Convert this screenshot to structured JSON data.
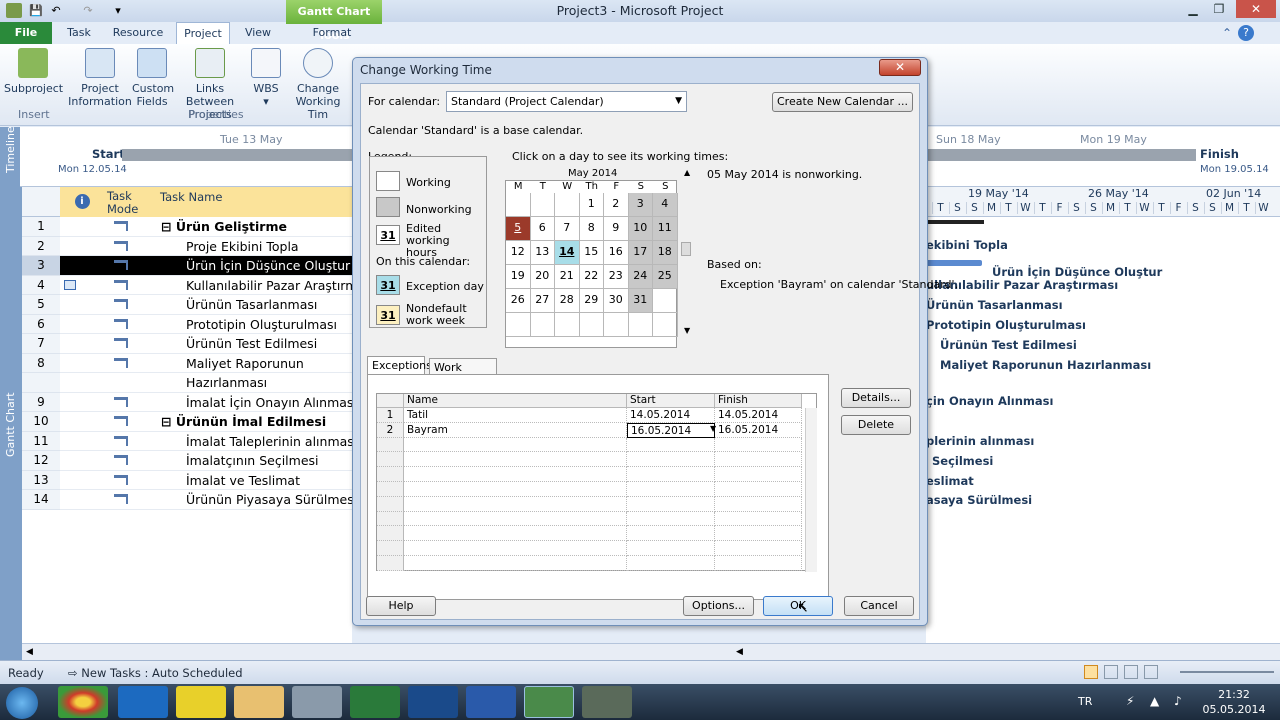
{
  "window": {
    "title": "Project3  -  Microsoft Project",
    "context_tab": "Gantt Chart Tools"
  },
  "ribbon": {
    "tabs": [
      "File",
      "Task",
      "Resource",
      "Project",
      "View",
      "Format"
    ],
    "active_tab": "Project",
    "buttons": [
      {
        "label": "Subproject",
        "label2": ""
      },
      {
        "label": "Project",
        "label2": "Information"
      },
      {
        "label": "Custom",
        "label2": "Fields"
      },
      {
        "label": "Links Between",
        "label2": "Projects"
      },
      {
        "label": "WBS",
        "label2": "▾"
      },
      {
        "label": "Change",
        "label2": "Working Tim"
      }
    ],
    "groups": [
      "Insert",
      "Properties"
    ]
  },
  "timeline": {
    "side_label": "Timeline",
    "start_label": "Start",
    "start_date": "Mon 12.05.14",
    "tue_label": "Tue 13 May",
    "sun_label": "Sun 18 May",
    "mon_label": "Mon 19 May",
    "finish_label": "Finish",
    "finish_date": "Mon 19.05.14"
  },
  "gantt": {
    "side_label": "Gantt Chart",
    "headers": {
      "info": "i",
      "mode": "Task Mode",
      "name": "Task Name"
    },
    "rows": [
      {
        "id": "1",
        "name": "⊟ Ürün Geliştirme"
      },
      {
        "id": "2",
        "name": "Proje Ekibini Topla"
      },
      {
        "id": "3",
        "name": "Ürün İçin Düşünce Oluştur"
      },
      {
        "id": "4",
        "name": "Kullanılabilir Pazar Araştırma"
      },
      {
        "id": "5",
        "name": "Ürünün Tasarlanması"
      },
      {
        "id": "6",
        "name": "Prototipin Oluşturulması"
      },
      {
        "id": "7",
        "name": "Ürünün Test Edilmesi"
      },
      {
        "id": "8",
        "name": "Maliyet Raporunun"
      },
      {
        "id": "8b",
        "name": "Hazırlanması"
      },
      {
        "id": "9",
        "name": "İmalat İçin Onayın Alınması"
      },
      {
        "id": "10",
        "name": "⊟ Ürünün İmal Edilmesi"
      },
      {
        "id": "11",
        "name": "İmalat Taleplerinin alınması"
      },
      {
        "id": "12",
        "name": "İmalatçının Seçilmesi"
      },
      {
        "id": "13",
        "name": "İmalat ve Teslimat"
      },
      {
        "id": "14",
        "name": "Ürünün Piyasaya Sürülmesi"
      }
    ],
    "weeks": [
      "19 May '14",
      "26 May '14",
      "02 Jun '14"
    ],
    "days": [
      "T",
      "S",
      "S",
      "M",
      "T",
      "W",
      "T",
      "F",
      "S",
      "S",
      "M",
      "T",
      "W",
      "T",
      "F",
      "S",
      "S",
      "M",
      "T",
      "W"
    ],
    "chart_labels": [
      "ekibini Topla",
      "Ürün İçin Düşünce Oluştur",
      "ullanılabilir Pazar Araştırması",
      "Ürünün Tasarlanması",
      "Prototipin Oluşturulması",
      "Ürünün Test Edilmesi",
      "Maliyet Raporunun Hazırlanması",
      "çin Onayın Alınması",
      "plerinin alınması",
      "Seçilmesi",
      "eslimat",
      "asaya Sürülmesi"
    ]
  },
  "status": {
    "ready": "Ready",
    "new_tasks": "New Tasks : Auto Scheduled"
  },
  "taskbar": {
    "lang": "TR",
    "time": "21:32",
    "date": "05.05.2014"
  },
  "dialog": {
    "title": "Change Working Time",
    "for_calendar_label": "For calendar:",
    "calendar_value": "Standard (Project Calendar)",
    "create_button": "Create New Calendar ...",
    "base_note": "Calendar 'Standard' is a base calendar.",
    "legend_title": "Legend:",
    "legend_items": [
      "Working",
      "Nonworking",
      "Edited working hours"
    ],
    "on_this_calendar": "On this calendar:",
    "legend_items2": [
      "Exception day",
      "Nondefault work week"
    ],
    "legend_num": "31",
    "click_hint": "Click on a day to see its working times:",
    "month": "May 2014",
    "weekdays": [
      "M",
      "T",
      "W",
      "Th",
      "F",
      "S",
      "S"
    ],
    "days": [
      [
        "",
        "",
        "",
        "1",
        "2",
        "3",
        "4"
      ],
      [
        "5",
        "6",
        "7",
        "8",
        "9",
        "10",
        "11"
      ],
      [
        "12",
        "13",
        "14",
        "15",
        "16",
        "17",
        "18"
      ],
      [
        "19",
        "20",
        "21",
        "22",
        "23",
        "24",
        "25"
      ],
      [
        "26",
        "27",
        "28",
        "29",
        "30",
        "31",
        ""
      ],
      [
        "",
        "",
        "",
        "",
        "",
        "",
        ""
      ]
    ],
    "day_info": "05 May 2014 is nonworking.",
    "based_on": "Based on:",
    "based_detail": "Exception 'Bayram' on calendar 'Standard'.",
    "tabs": [
      "Exceptions",
      "Work Weeks"
    ],
    "grid_headers": [
      "Name",
      "Start",
      "Finish"
    ],
    "exceptions": [
      {
        "n": "1",
        "name": "Tatil",
        "start": "14.05.2014",
        "finish": "14.05.2014"
      },
      {
        "n": "2",
        "name": "Bayram",
        "start": "16.05.2014",
        "finish": "16.05.2014"
      }
    ],
    "details_button": "Details...",
    "delete_button": "Delete",
    "help_button": "Help",
    "options_button": "Options...",
    "ok_button": "OK",
    "cancel_button": "Cancel"
  }
}
